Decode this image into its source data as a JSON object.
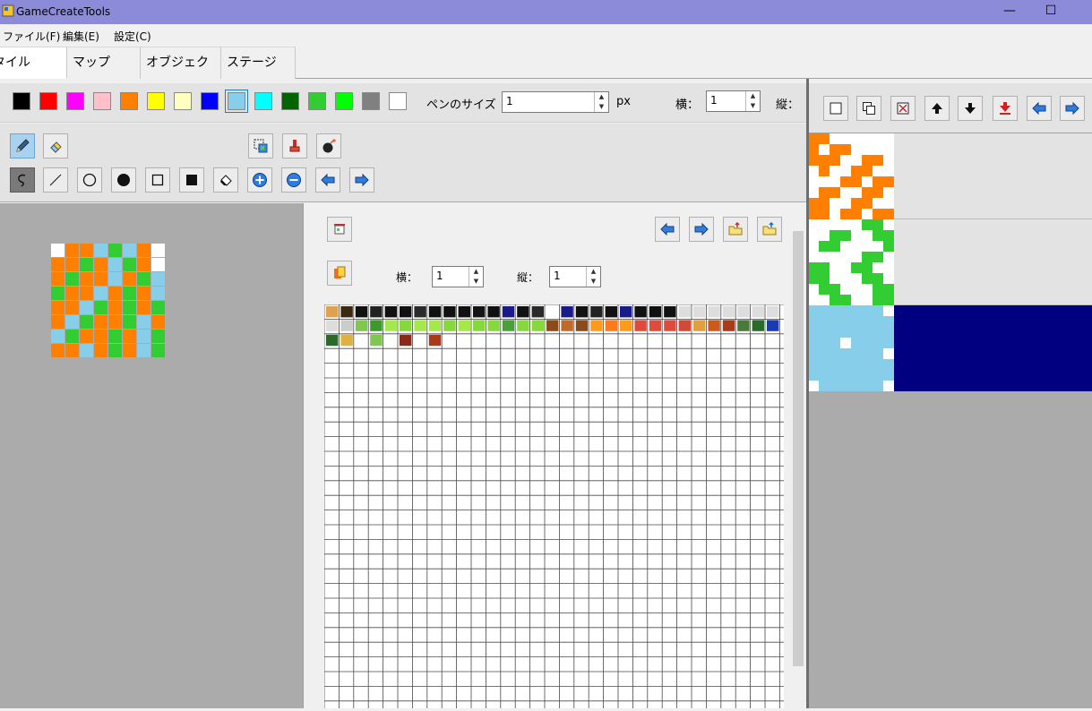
{
  "window": {
    "title": "GameCreateTools"
  },
  "menu": [
    "ファイル(F)",
    "編集(E)",
    "設定(C)"
  ],
  "tabs": [
    "タイル",
    "マップ",
    "オブジェクト",
    "ステージ"
  ],
  "palette": {
    "colors": [
      "#000000",
      "#ff0000",
      "#ff00ff",
      "#ffc0cb",
      "#ff8000",
      "#ffff00",
      "#ffffc0",
      "#0000ff",
      "#87ceeb",
      "#00ffff",
      "#006400",
      "#32cd32",
      "#00ff00",
      "#808080",
      "#ffffff"
    ],
    "selected_index": 8
  },
  "pen": {
    "label": "ペンのサイズ",
    "value": "1",
    "unit": "px"
  },
  "canvas_size": {
    "width_label": "横：",
    "width_value": "1",
    "height_label": "縦："
  },
  "tile_size": {
    "width_label": "横：",
    "width_value": "1",
    "height_label": "縦：",
    "height_value": "1"
  },
  "preview_colors": {
    "orange": "#ff8000",
    "green": "#32cd32",
    "sky": "#87ceeb",
    "white": "#ffffff",
    "navy": "#000080"
  },
  "icons": {
    "tools_row1": [
      "pencil-icon",
      "eraser-icon"
    ],
    "tools_row1_right": [
      "select-copy-icon",
      "fill-bucket-icon",
      "bomb-icon"
    ],
    "tools_row2": [
      "lasso-icon",
      "line-icon",
      "circle-outline-icon",
      "circle-filled-icon",
      "rect-outline-icon",
      "rect-filled-icon",
      "paint-fill-icon",
      "zoom-in-icon",
      "zoom-out-icon",
      "arrow-left-icon",
      "arrow-right-icon"
    ],
    "right_toolbar": [
      "new-icon",
      "copy-icon",
      "delete-icon",
      "move-up-icon",
      "move-down-icon",
      "move-bottom-icon",
      "arrow-left-icon",
      "arrow-right-icon"
    ]
  }
}
